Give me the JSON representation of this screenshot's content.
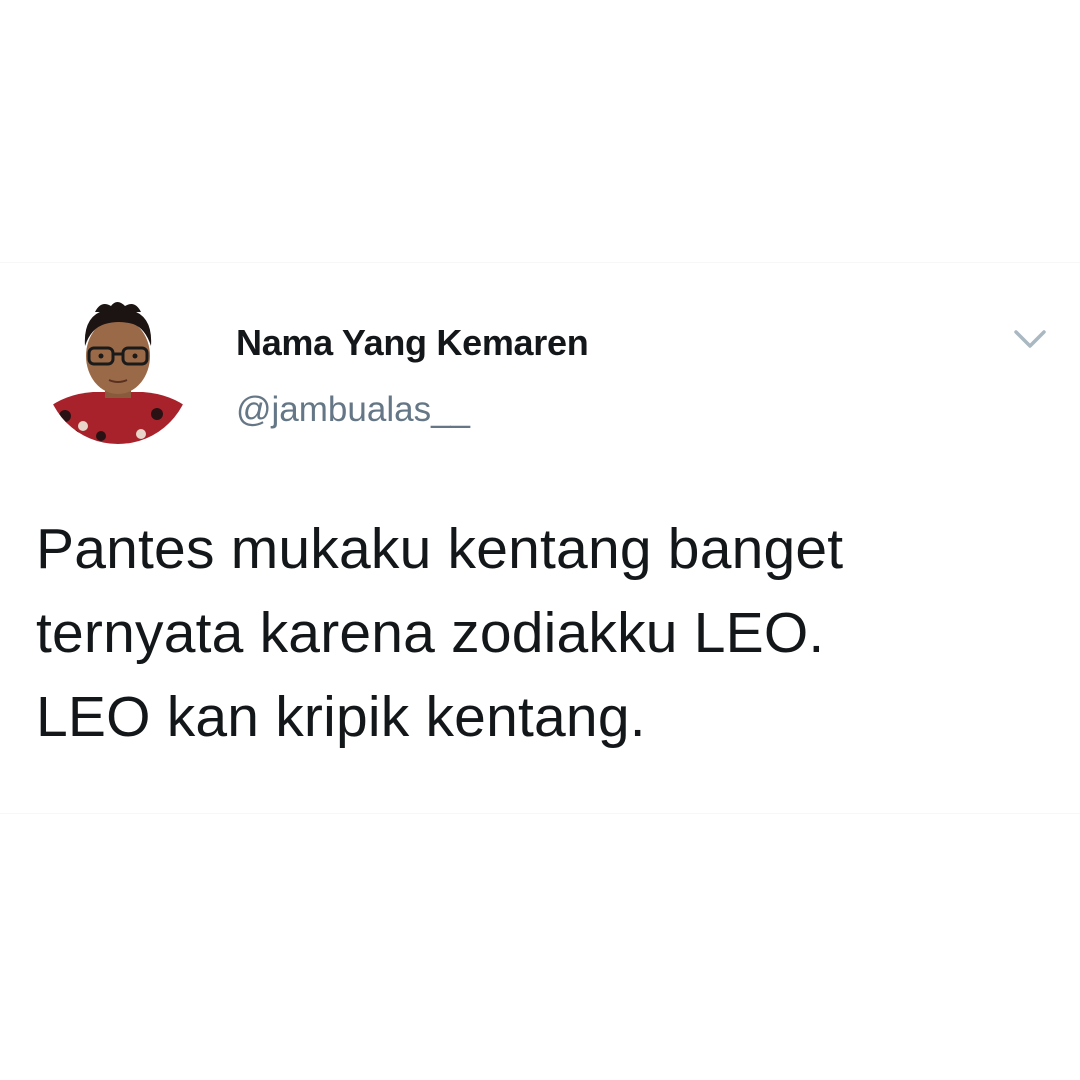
{
  "tweet": {
    "author": {
      "display_name": "Nama Yang Kemaren",
      "handle": "@jambualas__",
      "avatar_icon": "profile-photo"
    },
    "menu_icon": "chevron-down-icon",
    "text_lines": [
      "Pantes mukaku kentang banget",
      "ternyata karena zodiakku LEO.",
      "LEO kan kripik kentang."
    ]
  },
  "colors": {
    "background": "#ffffff",
    "name_text": "#14171a",
    "handle_text": "#657786",
    "body_text": "#14171a",
    "caret": "#aab8c2"
  }
}
